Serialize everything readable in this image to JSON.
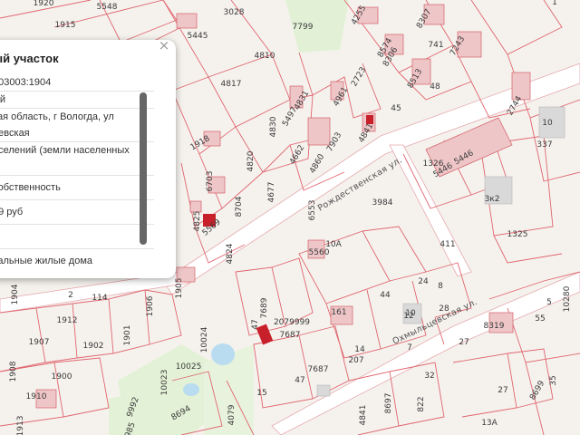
{
  "popup": {
    "title": "ый участок",
    "close_symbol": "×",
    "rows": [
      "503003:1904",
      "ый",
      "кая область, г Вологда, ул",
      "цевская",
      "оселений (земли населенных",
      ")",
      " собственность",
      "59 руб",
      "л",
      "уальные жилые дома"
    ]
  },
  "streets": {
    "rozhdestvenskaya": "Рождественская ул.",
    "okhmyltsevskaya": "Охмыльцевская ул."
  },
  "parcels": [
    "1920",
    "1915",
    "5548",
    "5445",
    "3028",
    "7799",
    "4255",
    "8307",
    "1",
    "4810",
    "8574",
    "8306",
    "741",
    "7243",
    "4817",
    "2723",
    "8513",
    "48",
    "2744",
    "10",
    "4831",
    "5497",
    "4961",
    "45",
    "4841",
    "337",
    "4830",
    "1918",
    "4820",
    "7903",
    "4662",
    "4860",
    "6703",
    "4677",
    "1326",
    "5446",
    "5446",
    "1926",
    "8704",
    "6553",
    "3к2",
    "3984",
    "4825",
    "5569",
    "4824",
    "10А",
    "5560",
    "411",
    "1325",
    "1904",
    "2",
    "114",
    "1906",
    "24",
    "8",
    "1905",
    "44",
    "12",
    "28",
    "1912",
    "7689",
    "2079999",
    "161",
    "10",
    "8319",
    "55",
    "10280",
    "1907",
    "1901",
    "1902",
    "47",
    "7687",
    "14",
    "7",
    "27",
    "5",
    "1908",
    "1900",
    "10024",
    "7687",
    "207",
    "35",
    "1910",
    "10025",
    "10023",
    "4079",
    "15",
    "47",
    "8697",
    "32",
    "27",
    "8699",
    "9992",
    "8694",
    "4841",
    "822",
    "1913",
    "9985",
    "13А"
  ],
  "colors": {
    "parcel_line": "#e0737b",
    "building_fill": "#eec6c8",
    "building_dark": "#c8202a",
    "road": "#ffffff",
    "vegetation": "#dff0cf",
    "water": "#b9dcf1"
  }
}
